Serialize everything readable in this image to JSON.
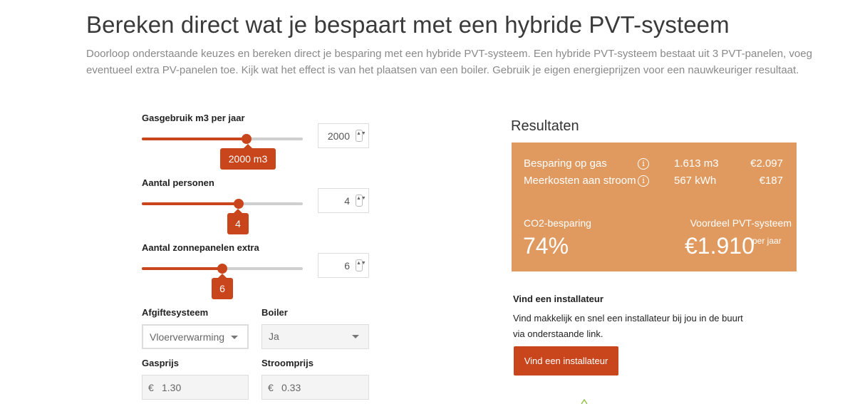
{
  "header": {
    "title": "Bereken direct wat je bespaart met een hybride PVT-systeem",
    "intro": "Doorloop onderstaande keuzes en bereken direct je besparing met een hybride PVT-systeem. Een hybride PVT-systeem bestaat uit 3 PVT-panelen, voeg eventueel extra PV-panelen toe. Kijk wat het effect is van het plaatsen van een boiler. Gebruik je eigen energieprijzen voor een nauwkeuriger resultaat."
  },
  "form": {
    "gas": {
      "label": "Gasgebruik m3 per jaar",
      "value": "2000",
      "bubble": "2000 m3",
      "fraction": 0.65
    },
    "persons": {
      "label": "Aantal personen",
      "value": "4",
      "bubble": "4",
      "fraction": 0.6
    },
    "panels": {
      "label": "Aantal zonnepanelen extra",
      "value": "6",
      "bubble": "6",
      "fraction": 0.5
    },
    "afgifte": {
      "label": "Afgiftesysteem",
      "value": "Vloerverwarming"
    },
    "boiler": {
      "label": "Boiler",
      "value": "Ja"
    },
    "gasprijs": {
      "label": "Gasprijs",
      "currency": "€",
      "value": "1.30"
    },
    "stroomprijs": {
      "label": "Stroomprijs",
      "currency": "€",
      "value": "0.33"
    },
    "spin_icon": "▲▼",
    "accent_color": "#c9461c"
  },
  "results": {
    "title": "Resultaten",
    "box_color": "#e09a5f",
    "gas_label": "Besparing op gas",
    "gas_amount": "1.613 m3",
    "gas_value": "€2.097",
    "power_label": "Meerkosten aan stroom",
    "power_amount": "567 kWh",
    "power_value": "€187",
    "info_icon": "i",
    "co2_label": "CO2-besparing",
    "co2_value": "74%",
    "benefit_label": "Voordeel PVT-systeem",
    "benefit_value": "€1.910",
    "per_year": "per jaar"
  },
  "installer": {
    "title": "Vind een installateur",
    "text": "Vind makkelijk en snel een installateur bij jou in de buurt via onderstaande link.",
    "button": "Vind een installateur"
  }
}
